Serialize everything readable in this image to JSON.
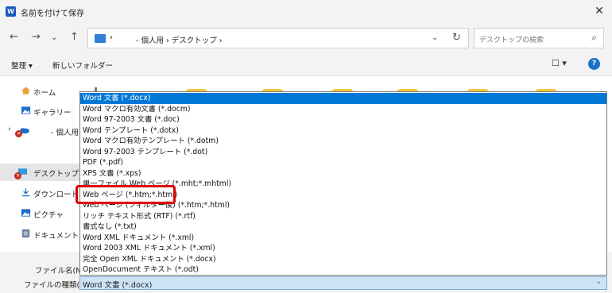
{
  "window": {
    "title": "名前を付けて保存",
    "app_icon_letter": "W"
  },
  "address": {
    "path_text": "- 個人用 › デスクトップ ›",
    "root_sep": "›"
  },
  "search": {
    "placeholder": "デスクトップの検索"
  },
  "toolbar": {
    "organize_label": "整理 ▾",
    "new_folder_label": "新しいフォルダー",
    "view_label": "☐ ▾",
    "help_label": "?"
  },
  "nav": {
    "items": [
      {
        "label": "ホーム",
        "icon": "home-icon"
      },
      {
        "label": "ギャラリー",
        "icon": "gallery-icon"
      },
      {
        "label": "- 個人用",
        "icon": "onedrive-icon"
      },
      {
        "label": "デスクトップ",
        "icon": "desktop-icon"
      },
      {
        "label": "ダウンロード",
        "icon": "download-icon"
      },
      {
        "label": "ピクチャ",
        "icon": "pictures-icon"
      },
      {
        "label": "ドキュメント",
        "icon": "documents-icon"
      }
    ]
  },
  "fields": {
    "filename_label": "ファイル名(N):",
    "filetype_label": "ファイルの種類(T):",
    "filetype_value": "Word 文書 (*.docx)"
  },
  "filetype_options": [
    "Word 文書 (*.docx)",
    "Word マクロ有効文書 (*.docm)",
    "Word 97-2003 文書 (*.doc)",
    "Word テンプレート (*.dotx)",
    "Word マクロ有効テンプレート (*.dotm)",
    "Word 97-2003 テンプレート (*.dot)",
    "PDF (*.pdf)",
    "XPS 文書 (*.xps)",
    "単一ファイル Web ページ (*.mht;*.mhtml)",
    "Web ページ (*.htm;*.html)",
    "Web ページ (フィルター後) (*.htm;*.html)",
    "リッチ テキスト形式 (RTF) (*.rtf)",
    "書式なし (*.txt)",
    "Word XML ドキュメント (*.xml)",
    "Word 2003 XML ドキュメント (*.xml)",
    "完全 Open XML ドキュメント (*.docx)",
    "OpenDocument テキスト (*.odt)"
  ],
  "selected_option_index": 0,
  "highlighted_option_index": 9,
  "colors": {
    "selection": "#0078d7",
    "highlight_border": "#e00000",
    "folder": "#f5c640"
  }
}
